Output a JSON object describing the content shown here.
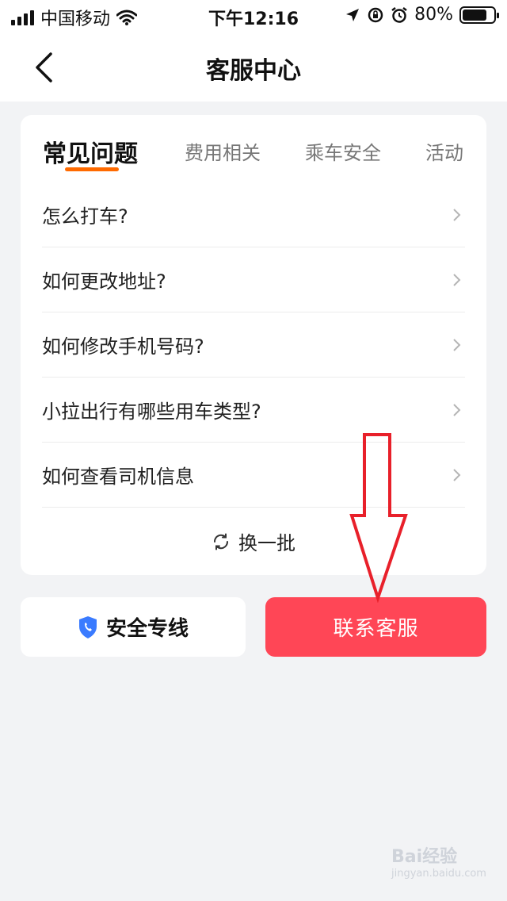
{
  "status_bar": {
    "carrier": "中国移动",
    "time": "下午12:16",
    "battery": "80%",
    "battery_level": 0.8
  },
  "header": {
    "title": "客服中心"
  },
  "tabs": [
    {
      "label": "常见问题",
      "active": true
    },
    {
      "label": "费用相关",
      "active": false
    },
    {
      "label": "乘车安全",
      "active": false
    },
    {
      "label": "活动",
      "active": false
    }
  ],
  "faq": [
    {
      "question": "怎么打车?"
    },
    {
      "question": "如何更改地址?"
    },
    {
      "question": "如何修改手机号码?"
    },
    {
      "question": "小拉出行有哪些用车类型?"
    },
    {
      "question": "如何查看司机信息"
    }
  ],
  "refresh_label": "换一批",
  "buttons": {
    "safety_line": "安全专线",
    "contact_service": "联系客服"
  },
  "watermark": {
    "logo": "Bai经验",
    "site": "jingyan.baidu.com"
  },
  "colors": {
    "accent": "#ff6a00",
    "contact_button": "#ff4656",
    "shield": "#3a7bff",
    "annotation_arrow": "#e8202a"
  },
  "icons": [
    "back-chevron-icon",
    "signal-icon",
    "wifi-icon",
    "location-icon",
    "rotation-lock-icon",
    "alarm-icon",
    "battery-icon",
    "chevron-right-icon",
    "refresh-icon",
    "shield-phone-icon"
  ]
}
